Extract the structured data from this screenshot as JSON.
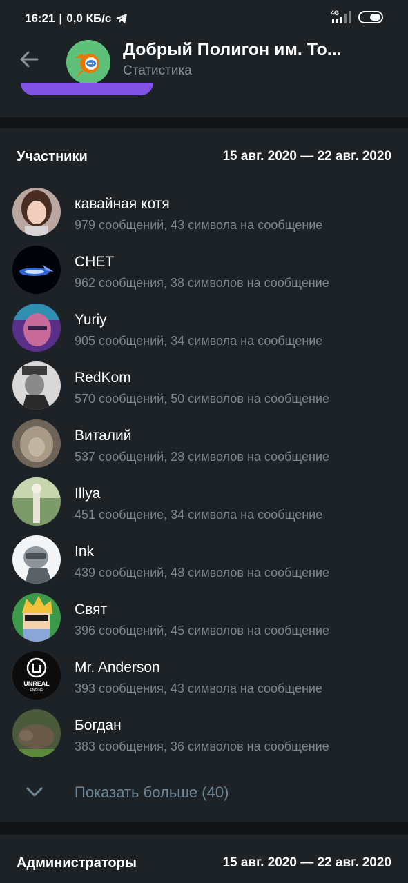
{
  "statusbar": {
    "time": "16:21",
    "speed": "0,0 КБ/с",
    "network": "4G"
  },
  "header": {
    "title": "Добрый Полигон им. То...",
    "subtitle": "Статистика"
  },
  "members_section": {
    "title": "Участники",
    "range": "15 авг. 2020 — 22 авг. 2020",
    "items": [
      {
        "name": "кавайная котя",
        "stats": "979 сообщений, 43 символа на сообщение"
      },
      {
        "name": "CHET",
        "stats": "962 сообщения, 38 символов на сообщение"
      },
      {
        "name": "Yuriy",
        "stats": "905 сообщений, 34 символа на сообщение"
      },
      {
        "name": "RedKom",
        "stats": "570 сообщений, 50 символов на сообщение"
      },
      {
        "name": "Виталий",
        "stats": "537 сообщений, 28 символов на сообщение"
      },
      {
        "name": "Illya",
        "stats": "451 сообщение, 34 символа на сообщение"
      },
      {
        "name": "Ink",
        "stats": "439 сообщений, 48 символов на сообщение"
      },
      {
        "name": "Свят",
        "stats": "396 сообщений, 45 символов на сообщение"
      },
      {
        "name": "Mr. Anderson",
        "stats": "393 сообщения, 43 символа на сообщение"
      },
      {
        "name": "Богдан",
        "stats": "383 сообщения, 36 символов на сообщение"
      }
    ],
    "show_more": "Показать больше (40)"
  },
  "admins_section": {
    "title": "Администраторы",
    "range": "15 авг. 2020 — 22 авг. 2020"
  },
  "avatar_logo_text": {
    "unreal": "UNREAL",
    "engine": "ENGINE"
  },
  "colors": {
    "background": "#111518",
    "card": "#1d2226",
    "secondary_text": "#7d868d",
    "accent_purple": "#8152e3",
    "show_more": "#6e8696"
  }
}
